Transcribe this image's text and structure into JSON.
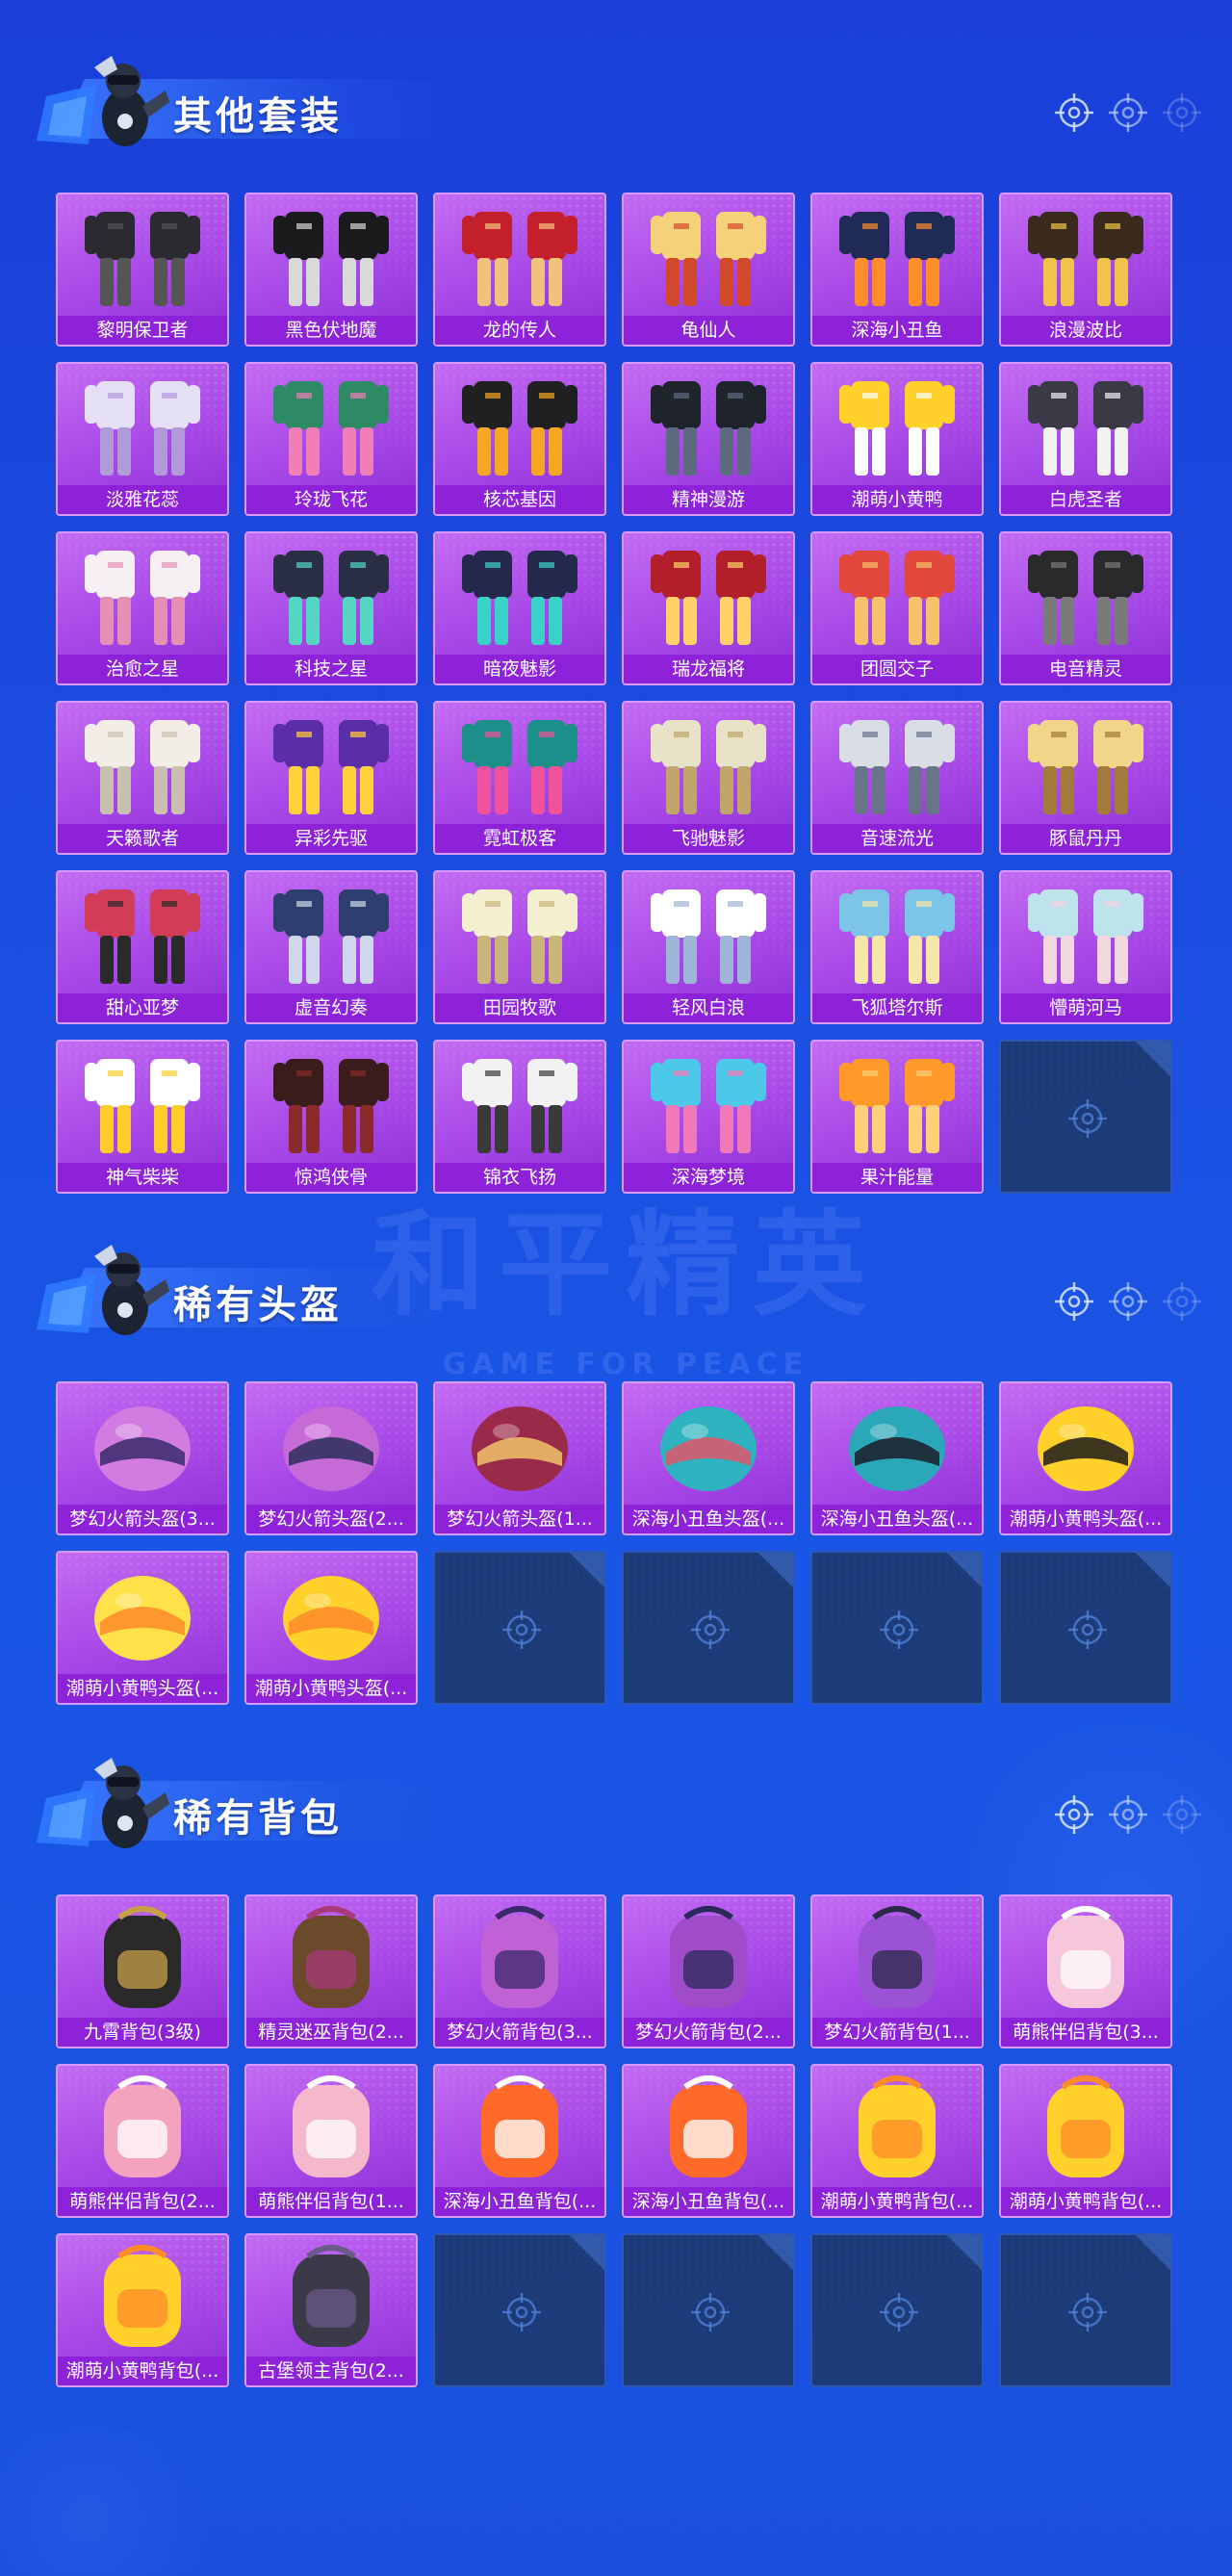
{
  "watermark": {
    "title": "和平精英",
    "subtitle": "GAME FOR PEACE"
  },
  "sections": [
    {
      "title": "其他套装",
      "items": [
        "黎明保卫者",
        "黑色伏地魔",
        "龙的传人",
        "龟仙人",
        "深海小丑鱼",
        "浪漫波比",
        "淡雅花蕊",
        "玲珑飞花",
        "核芯基因",
        "精神漫游",
        "潮萌小黄鸭",
        "白虎圣者",
        "治愈之星",
        "科技之星",
        "暗夜魅影",
        "瑞龙福将",
        "团圆交子",
        "电音精灵",
        "天籁歌者",
        "异彩先驱",
        "霓虹极客",
        "飞驰魅影",
        "音速流光",
        "豚鼠丹丹",
        "甜心亚梦",
        "虚音幻奏",
        "田园牧歌",
        "轻风白浪",
        "飞狐塔尔斯",
        "懵萌河马",
        "神气柴柴",
        "惊鸿侠骨",
        "锦衣飞扬",
        "深海梦境",
        "果汁能量"
      ],
      "empty_slots": 1
    },
    {
      "title": "稀有头盔",
      "items": [
        "梦幻火箭头盔(3...",
        "梦幻火箭头盔(2...",
        "梦幻火箭头盔(1...",
        "深海小丑鱼头盔(...",
        "深海小丑鱼头盔(...",
        "潮萌小黄鸭头盔(...",
        "潮萌小黄鸭头盔(...",
        "潮萌小黄鸭头盔(..."
      ],
      "empty_slots": 4
    },
    {
      "title": "稀有背包",
      "items": [
        "九霄背包(3级)",
        "精灵迷巫背包(2...",
        "梦幻火箭背包(3...",
        "梦幻火箭背包(2...",
        "梦幻火箭背包(1...",
        "萌熊伴侣背包(3...",
        "萌熊伴侣背包(2...",
        "萌熊伴侣背包(1...",
        "深海小丑鱼背包(...",
        "深海小丑鱼背包(...",
        "潮萌小黄鸭背包(...",
        "潮萌小黄鸭背包(...",
        "潮萌小黄鸭背包(...",
        "古堡领主背包(2..."
      ],
      "empty_slots": 4
    }
  ],
  "colors": {
    "card_bg": "#a647e6",
    "label_bg": "#8e22d9",
    "empty_bg": "#1c3b78",
    "page_bg": "#1b4ee0"
  },
  "icons": {
    "header_mascot": "soldier-mascot-icon",
    "header_deco": "crosshair-icon",
    "empty_slot": "crosshair-icon"
  }
}
